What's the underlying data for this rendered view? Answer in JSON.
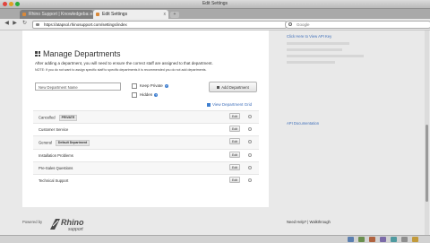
{
  "window": {
    "title": "Edit Settings"
  },
  "tabs": [
    {
      "label": "Rhino Support | Knowledgebase"
    },
    {
      "label": "Edit Settings"
    }
  ],
  "tab_close_glyph": "x",
  "new_tab_glyph": "+",
  "address": {
    "url": "https://atapsol.rhinosupport.com/settings/index"
  },
  "search": {
    "placeholder": "Google"
  },
  "page": {
    "heading": "Manage Departments",
    "description": "After adding a department, you will need to ensure the correct staff are assigned to that department.",
    "note": "NOTE: If you do not want to assign specific staff to specific departments it is recommended you do not add departments.",
    "new_dept_placeholder": "New Department Name",
    "keep_private_label": "Keep Private",
    "hidden_label": "Hidden",
    "help_glyph": "?",
    "add_button_label": "Add Department",
    "view_all_link": "View Department Grid",
    "edit_label": "Edit",
    "departments": [
      {
        "name": "Cancelled",
        "badge": "PRIVATE"
      },
      {
        "name": "Customer Service",
        "badge": ""
      },
      {
        "name": "General",
        "badge": "Default Department"
      },
      {
        "name": "Installation Problems",
        "badge": ""
      },
      {
        "name": "Pre-Sales Questions",
        "badge": ""
      },
      {
        "name": "Technical Support",
        "badge": ""
      }
    ]
  },
  "sidebar": {
    "link_top": "Click Here to View API Key",
    "link_mid": "API Documentation"
  },
  "footer": {
    "powered_by": "Powered by",
    "logo_text": "Rhino",
    "logo_sub": "support",
    "need_help": "Need Help? | Walkthrough"
  },
  "icons": [
    "lock-icon",
    "search-icon",
    "back-arrow-icon",
    "forward-arrow-icon",
    "reload-icon",
    "departments-grid-icon",
    "help-icon",
    "gear-icon"
  ],
  "colors": {
    "link": "#3f6fba",
    "help_badge": "#3f7fd0",
    "logo": "#4a4a4a"
  }
}
